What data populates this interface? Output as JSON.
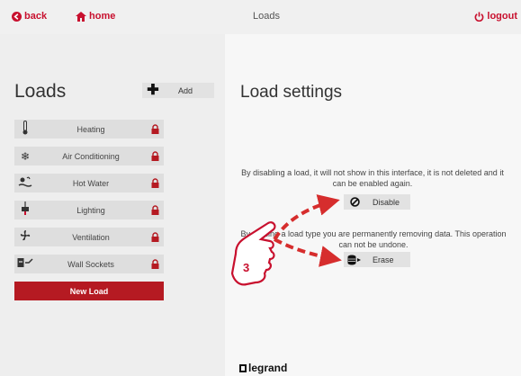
{
  "nav": {
    "back_label": "back",
    "home_label": "home",
    "title": "Loads",
    "logout_label": "logout"
  },
  "loads": {
    "title": "Loads",
    "add_label": "Add",
    "items": [
      {
        "label": "Heating",
        "icon": "thermometer-icon",
        "locked": true
      },
      {
        "label": "Air Conditioning",
        "icon": "snowflake-icon",
        "locked": true
      },
      {
        "label": "Hot Water",
        "icon": "hot-water-icon",
        "locked": true
      },
      {
        "label": "Lighting",
        "icon": "lamp-icon",
        "locked": true
      },
      {
        "label": "Ventilation",
        "icon": "fan-icon",
        "locked": true
      },
      {
        "label": "Wall Sockets",
        "icon": "socket-icon",
        "locked": true
      }
    ],
    "new_load_label": "New Load"
  },
  "settings": {
    "title": "Load settings",
    "disable_text": "By disabling a load, it will not show in this interface, it is not deleted and it can be enabled again.",
    "disable_label": "Disable",
    "erase_text": "By erasing a load type you are permanently removing data. This operation can not be undone.",
    "erase_label": "Erase"
  },
  "annotation": {
    "step_number": "3"
  },
  "logo": {
    "text": "legrand"
  },
  "colors": {
    "accent": "#c8102e",
    "new_load_bg": "#b51a22",
    "row_bg": "#dedede"
  }
}
